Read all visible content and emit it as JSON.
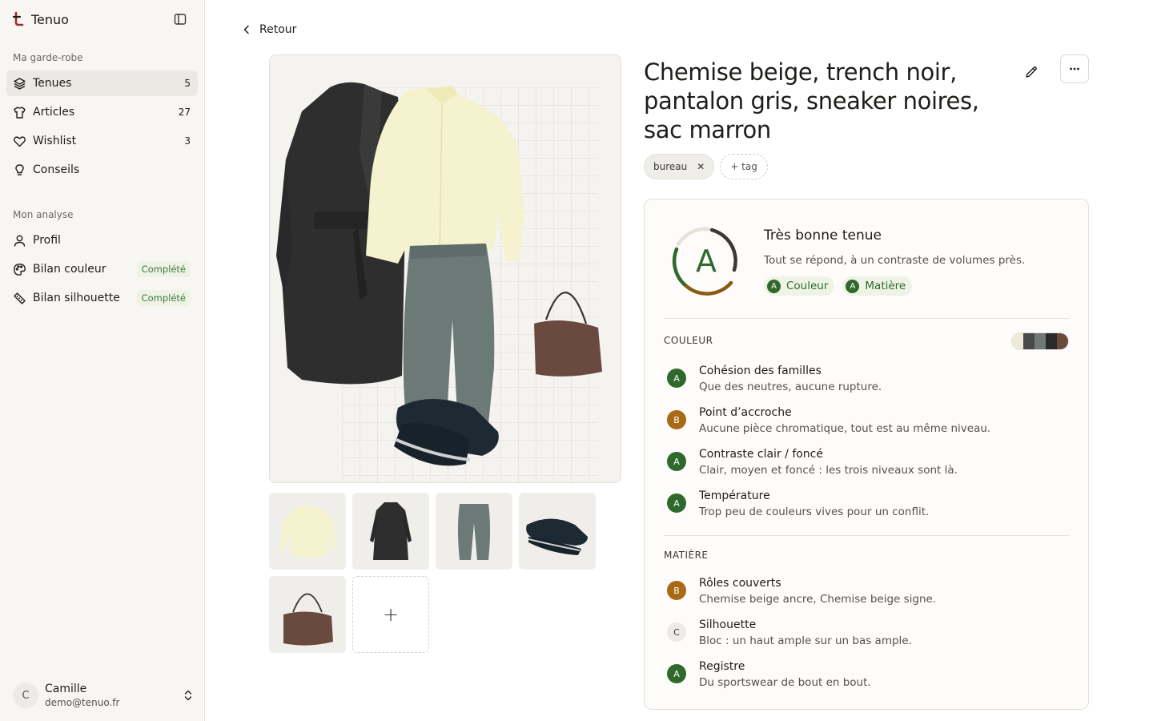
{
  "app": {
    "name": "Tenuo"
  },
  "sidebar": {
    "wardrobe_label": "Ma garde-robe",
    "wardrobe_items": [
      {
        "label": "Tenues",
        "count": "5",
        "icon": "layers-icon",
        "active": true
      },
      {
        "label": "Articles",
        "count": "27",
        "icon": "shirt-icon"
      },
      {
        "label": "Wishlist",
        "count": "3",
        "icon": "heart-icon"
      },
      {
        "label": "Conseils",
        "count": "",
        "icon": "lightbulb-icon"
      }
    ],
    "analysis_label": "Mon analyse",
    "analysis_items": [
      {
        "label": "Profil",
        "badge": "",
        "icon": "user-icon"
      },
      {
        "label": "Bilan couleur",
        "badge": "Complété",
        "icon": "palette-icon"
      },
      {
        "label": "Bilan silhouette",
        "badge": "Complété",
        "icon": "ruler-icon"
      }
    ],
    "user": {
      "initial": "C",
      "name": "Camille",
      "email": "demo@tenuo.fr"
    }
  },
  "main": {
    "back_label": "Retour",
    "title": "Chemise beige, trench noir, pantalon gris, sneaker noires, sac marron",
    "tags": [
      {
        "label": "bureau"
      }
    ],
    "add_tag_label": "+ tag",
    "add_thumb_label": "+",
    "thumbnails": [
      "shirt",
      "trench",
      "pants",
      "sneakers",
      "bag"
    ]
  },
  "analysis": {
    "grade": "A",
    "score": 0.72,
    "verdict_title": "Très bonne tenue",
    "verdict_subtitle": "Tout se répond, à un contraste de volumes près.",
    "chips": [
      {
        "grade": "A",
        "label": "Couleur"
      },
      {
        "grade": "A",
        "label": "Matière"
      }
    ],
    "color_section": {
      "label": "COULEUR",
      "swatches": [
        "#efead7",
        "#4a4a4a",
        "#6f7a78",
        "#2a2a2a",
        "#6a4a3a"
      ],
      "criteria": [
        {
          "grade": "A",
          "title": "Cohésion des familles",
          "desc": "Que des neutres, aucune rupture."
        },
        {
          "grade": "B",
          "title": "Point d’accroche",
          "desc": "Aucune pièce chromatique, tout est au même niveau."
        },
        {
          "grade": "A",
          "title": "Contraste clair / foncé",
          "desc": "Clair, moyen et foncé : les trois niveaux sont là."
        },
        {
          "grade": "A",
          "title": "Température",
          "desc": "Trop peu de couleurs vives pour un conflit."
        }
      ]
    },
    "material_section": {
      "label": "MATIÈRE",
      "criteria": [
        {
          "grade": "B",
          "title": "Rôles couverts",
          "desc": "Chemise beige ancre, Chemise beige signe."
        },
        {
          "grade": "C",
          "title": "Silhouette",
          "desc": "Bloc : un haut ample sur un bas ample."
        },
        {
          "grade": "A",
          "title": "Registre",
          "desc": "Du sportswear de bout en bout."
        }
      ]
    }
  },
  "colors": {
    "grade_a": "#2f6a2c",
    "grade_b": "#a96a16",
    "ring_green": "#2f6a2c",
    "ring_brown": "#8a5a14",
    "ring_dark": "#3b3935",
    "brand": "#a02c2c"
  }
}
